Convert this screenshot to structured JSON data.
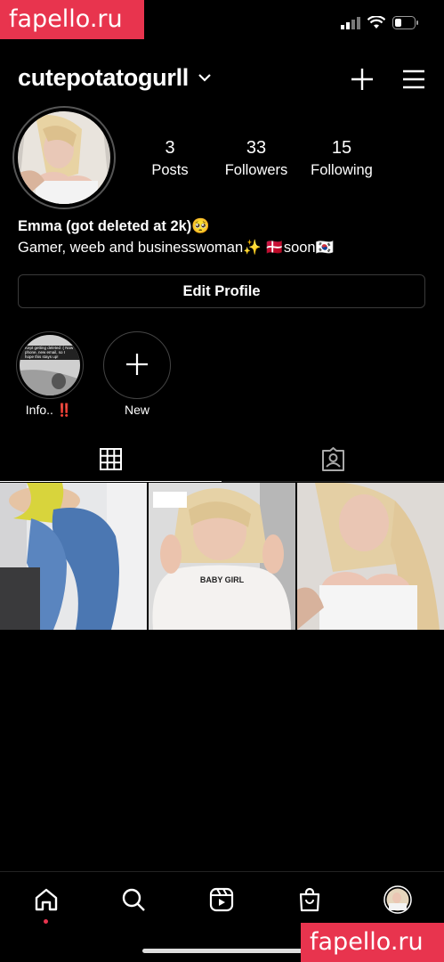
{
  "watermark": {
    "text": "fapello.ru"
  },
  "header": {
    "username": "cutepotatogurll"
  },
  "stats": [
    {
      "value": "3",
      "label": "Posts"
    },
    {
      "value": "33",
      "label": "Followers"
    },
    {
      "value": "15",
      "label": "Following"
    }
  ],
  "bio": {
    "name": "Emma (got deleted at 2k)🥺",
    "text": "Gamer, weeb and businesswoman✨ 🇩🇰soon🇰🇷"
  },
  "edit_profile_label": "Edit Profile",
  "highlights": [
    {
      "label": "Info.. ‼️"
    },
    {
      "label": "New"
    }
  ],
  "tabs": {
    "grid": "grid-icon",
    "tagged": "tagged-icon"
  },
  "posts": [
    {
      "caption": ""
    },
    {
      "caption": "BABY GIRL"
    },
    {
      "caption": ""
    }
  ],
  "highlight_thumb_text": "Kept getting deleted :( Now phone, new email, so I hope this stays up!",
  "bottom_nav": [
    "home-icon",
    "search-icon",
    "reels-icon",
    "shop-icon",
    "profile-avatar"
  ],
  "colors": {
    "accent": "#e8344e",
    "background": "#000000"
  }
}
